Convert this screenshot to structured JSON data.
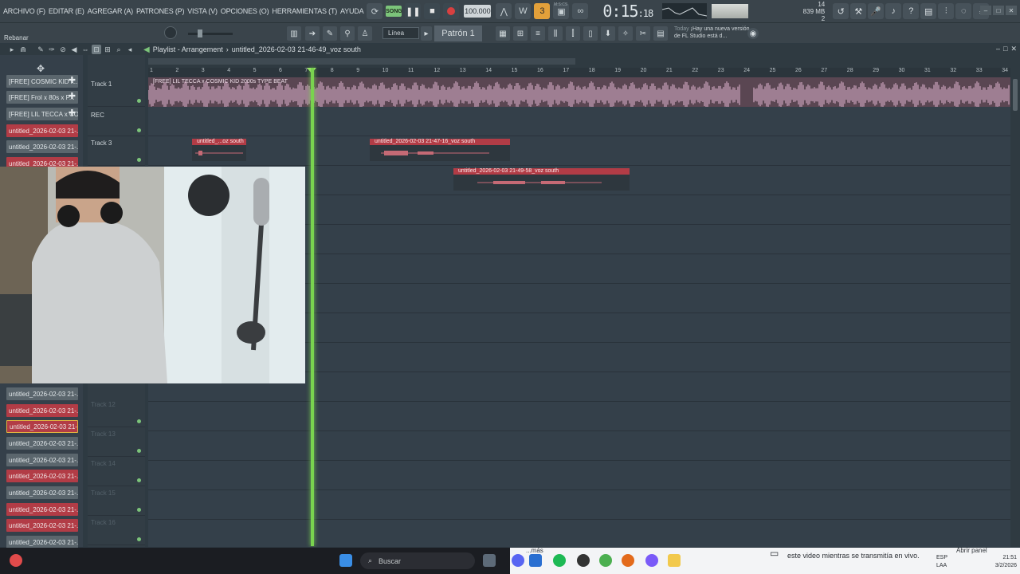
{
  "menu": [
    "ARCHIVO (F)",
    "EDITAR (E)",
    "AGREGAR (A)",
    "PATRONES (P)",
    "VISTA (V)",
    "OPCIONES (O)",
    "HERRAMIENTAS (T)",
    "AYUDA"
  ],
  "transport": {
    "song_label": "SONG",
    "tempo": "100.000",
    "time_main": "0:15",
    "time_frac": "18",
    "time_unit": "M:S:CS",
    "mem_top": "14",
    "mem_value": "839 MB",
    "mem_bottom": "2"
  },
  "toolbar2": {
    "hint": "Rebanar",
    "snap": "Línea",
    "pattern": "Patrón 1",
    "news_when": "Today",
    "news_text": "¡Hay una nueva versión de FL Studio está d..."
  },
  "playlist": {
    "title": "Playlist - Arrangement",
    "sep": "›",
    "project": "untitled_2026-02-03 21-46-49_voz south"
  },
  "picker": [
    {
      "label": "[FREE] COSMIC KID x...",
      "style": "gray",
      "plus": true
    },
    {
      "label": "[FREE] Frol x 80s x P...",
      "style": "gray",
      "plus": true
    },
    {
      "label": "[FREE] LIL TECCA x CO...",
      "style": "gray",
      "plus": true
    },
    {
      "label": "untitled_2026-02-03 21-...",
      "style": "red"
    },
    {
      "label": "untitled_2026-02-03 21-...",
      "style": "gray"
    },
    {
      "label": "untitled_2026-02-03 21-...",
      "style": "red"
    },
    {
      "label": "untitled_2026-02-03 21-...",
      "style": "gray"
    },
    {
      "label": "untitled_2026-02-03 21-...",
      "style": "red"
    },
    {
      "label": "untitled_2026-02-03 21-...",
      "style": "red",
      "selected": true
    },
    {
      "label": "untitled_2026-02-03 21-...",
      "style": "gray"
    },
    {
      "label": "untitled_2026-02-03 21-...",
      "style": "gray"
    },
    {
      "label": "untitled_2026-02-03 21-...",
      "style": "red"
    },
    {
      "label": "untitled_2026-02-03 21-...",
      "style": "gray"
    },
    {
      "label": "untitled_2026-02-03 21-...",
      "style": "red"
    },
    {
      "label": "untitled_2026-02-03 21-...",
      "style": "red"
    },
    {
      "label": "untitled_2026-02-03 21-...",
      "style": "gray"
    }
  ],
  "tracks": [
    "Track 1",
    "REC",
    "Track 3",
    "Track 12",
    "Track 13",
    "Track 14",
    "Track 15",
    "Track 16"
  ],
  "ruler": [
    "1",
    "2",
    "3",
    "4",
    "5",
    "6",
    "7",
    "8",
    "9",
    "10",
    "11",
    "12",
    "13",
    "14",
    "15",
    "16",
    "17",
    "18",
    "19",
    "20",
    "21",
    "22",
    "23",
    "24",
    "25",
    "26",
    "27",
    "28",
    "29",
    "30",
    "31",
    "32",
    "33",
    "34"
  ],
  "clips": {
    "beat": "[FREE] LIL TECCA x COSMIC KID 2000s TYPE BEAT",
    "c1": "untitled_...oz south",
    "c2": "untitled_2026-02-03 21-47-16_voz south",
    "c3": "untitled_2026-02-03 21-49-58_voz south"
  },
  "taskbar": {
    "search": "Buscar",
    "more": "...más",
    "notice": "este video mientras se transmitía en vivo.",
    "panel": "Abrir panel",
    "lang_top": "ESP",
    "lang_bottom": "LAA",
    "time": "21:51",
    "date": "3/2/2026"
  },
  "colors": {
    "accent_green": "#79d34f",
    "clip_red": "#b23c46",
    "audio_pink": "#e2b6d2"
  }
}
